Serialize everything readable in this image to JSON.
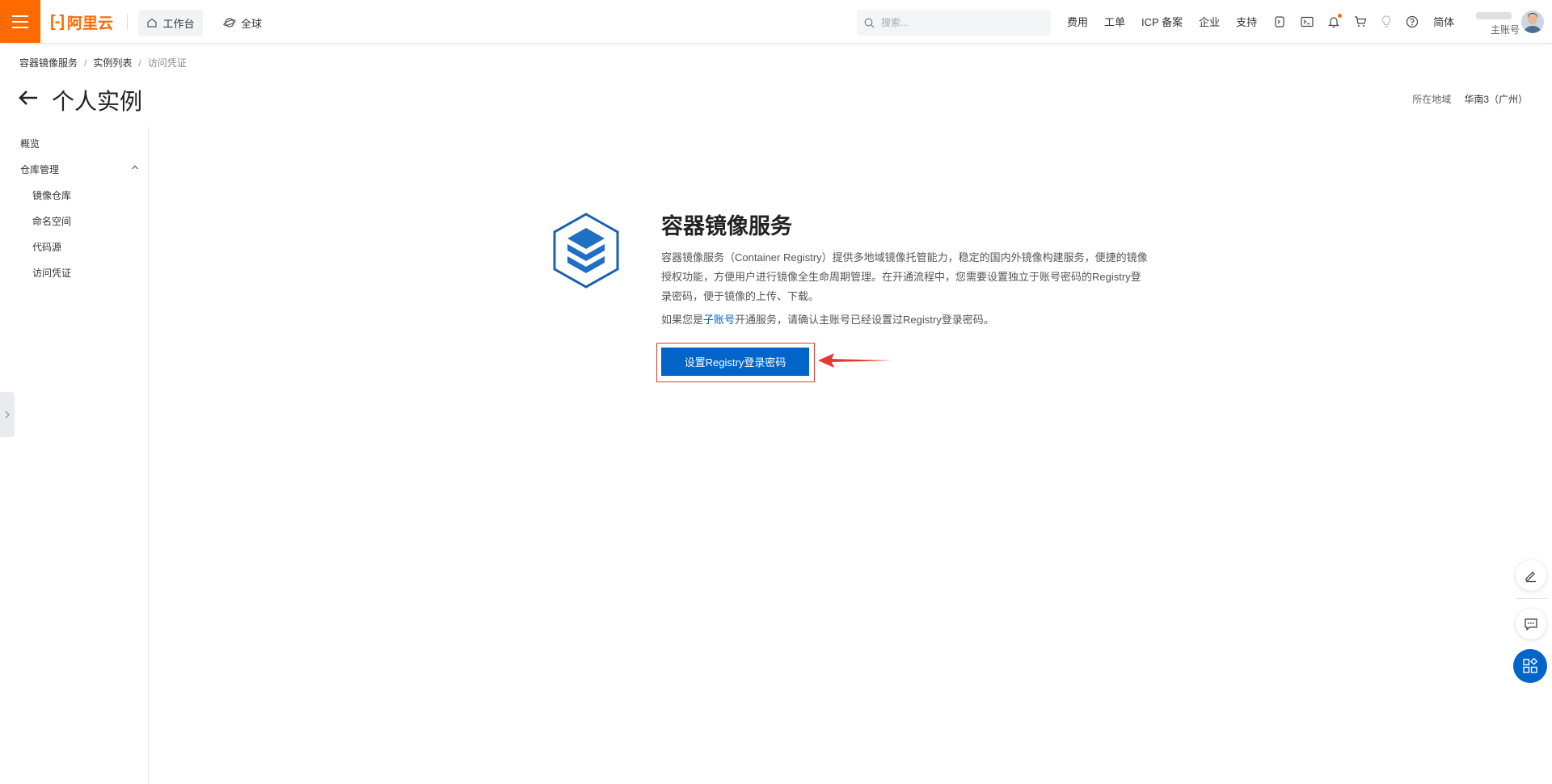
{
  "topbar": {
    "logo_text": "阿里云",
    "workbench_label": "工作台",
    "region_label": "全球",
    "search_placeholder": "搜索...",
    "links": [
      "费用",
      "工单",
      "ICP 备案",
      "企业",
      "支持"
    ],
    "lang_label": "简体",
    "account_label": "主账号",
    "icons": [
      "cloud-shell-icon",
      "terminal-icon",
      "bell-icon",
      "cart-icon",
      "lightbulb-icon",
      "help-icon"
    ],
    "accent_color": "#ff6a00"
  },
  "breadcrumb": {
    "items": [
      "容器镜像服务",
      "实例列表",
      "访问凭证"
    ]
  },
  "page": {
    "title": "个人实例",
    "region_label": "所在地域",
    "region_value": "华南3（广州）"
  },
  "sidebar": {
    "items": [
      {
        "label": "概览"
      },
      {
        "label": "仓库管理"
      },
      {
        "label": "镜像仓库"
      },
      {
        "label": "命名空间"
      },
      {
        "label": "代码源"
      },
      {
        "label": "访问凭证"
      }
    ]
  },
  "main": {
    "product_title": "容器镜像服务",
    "description": "容器镜像服务（Container Registry）提供多地域镜像托管能力，稳定的国内外镜像构建服务，便捷的镜像授权功能，方便用户进行镜像全生命周期管理。在开通流程中，您需要设置独立于账号密码的Registry登录密码，便于镜像的上传、下载。",
    "note_prefix": "如果您是",
    "note_link": "子账号",
    "note_suffix": "开通服务，请确认主账号已经设置过Registry登录密码。",
    "button_label": "设置Registry登录密码",
    "primary_color": "#0064c8"
  }
}
